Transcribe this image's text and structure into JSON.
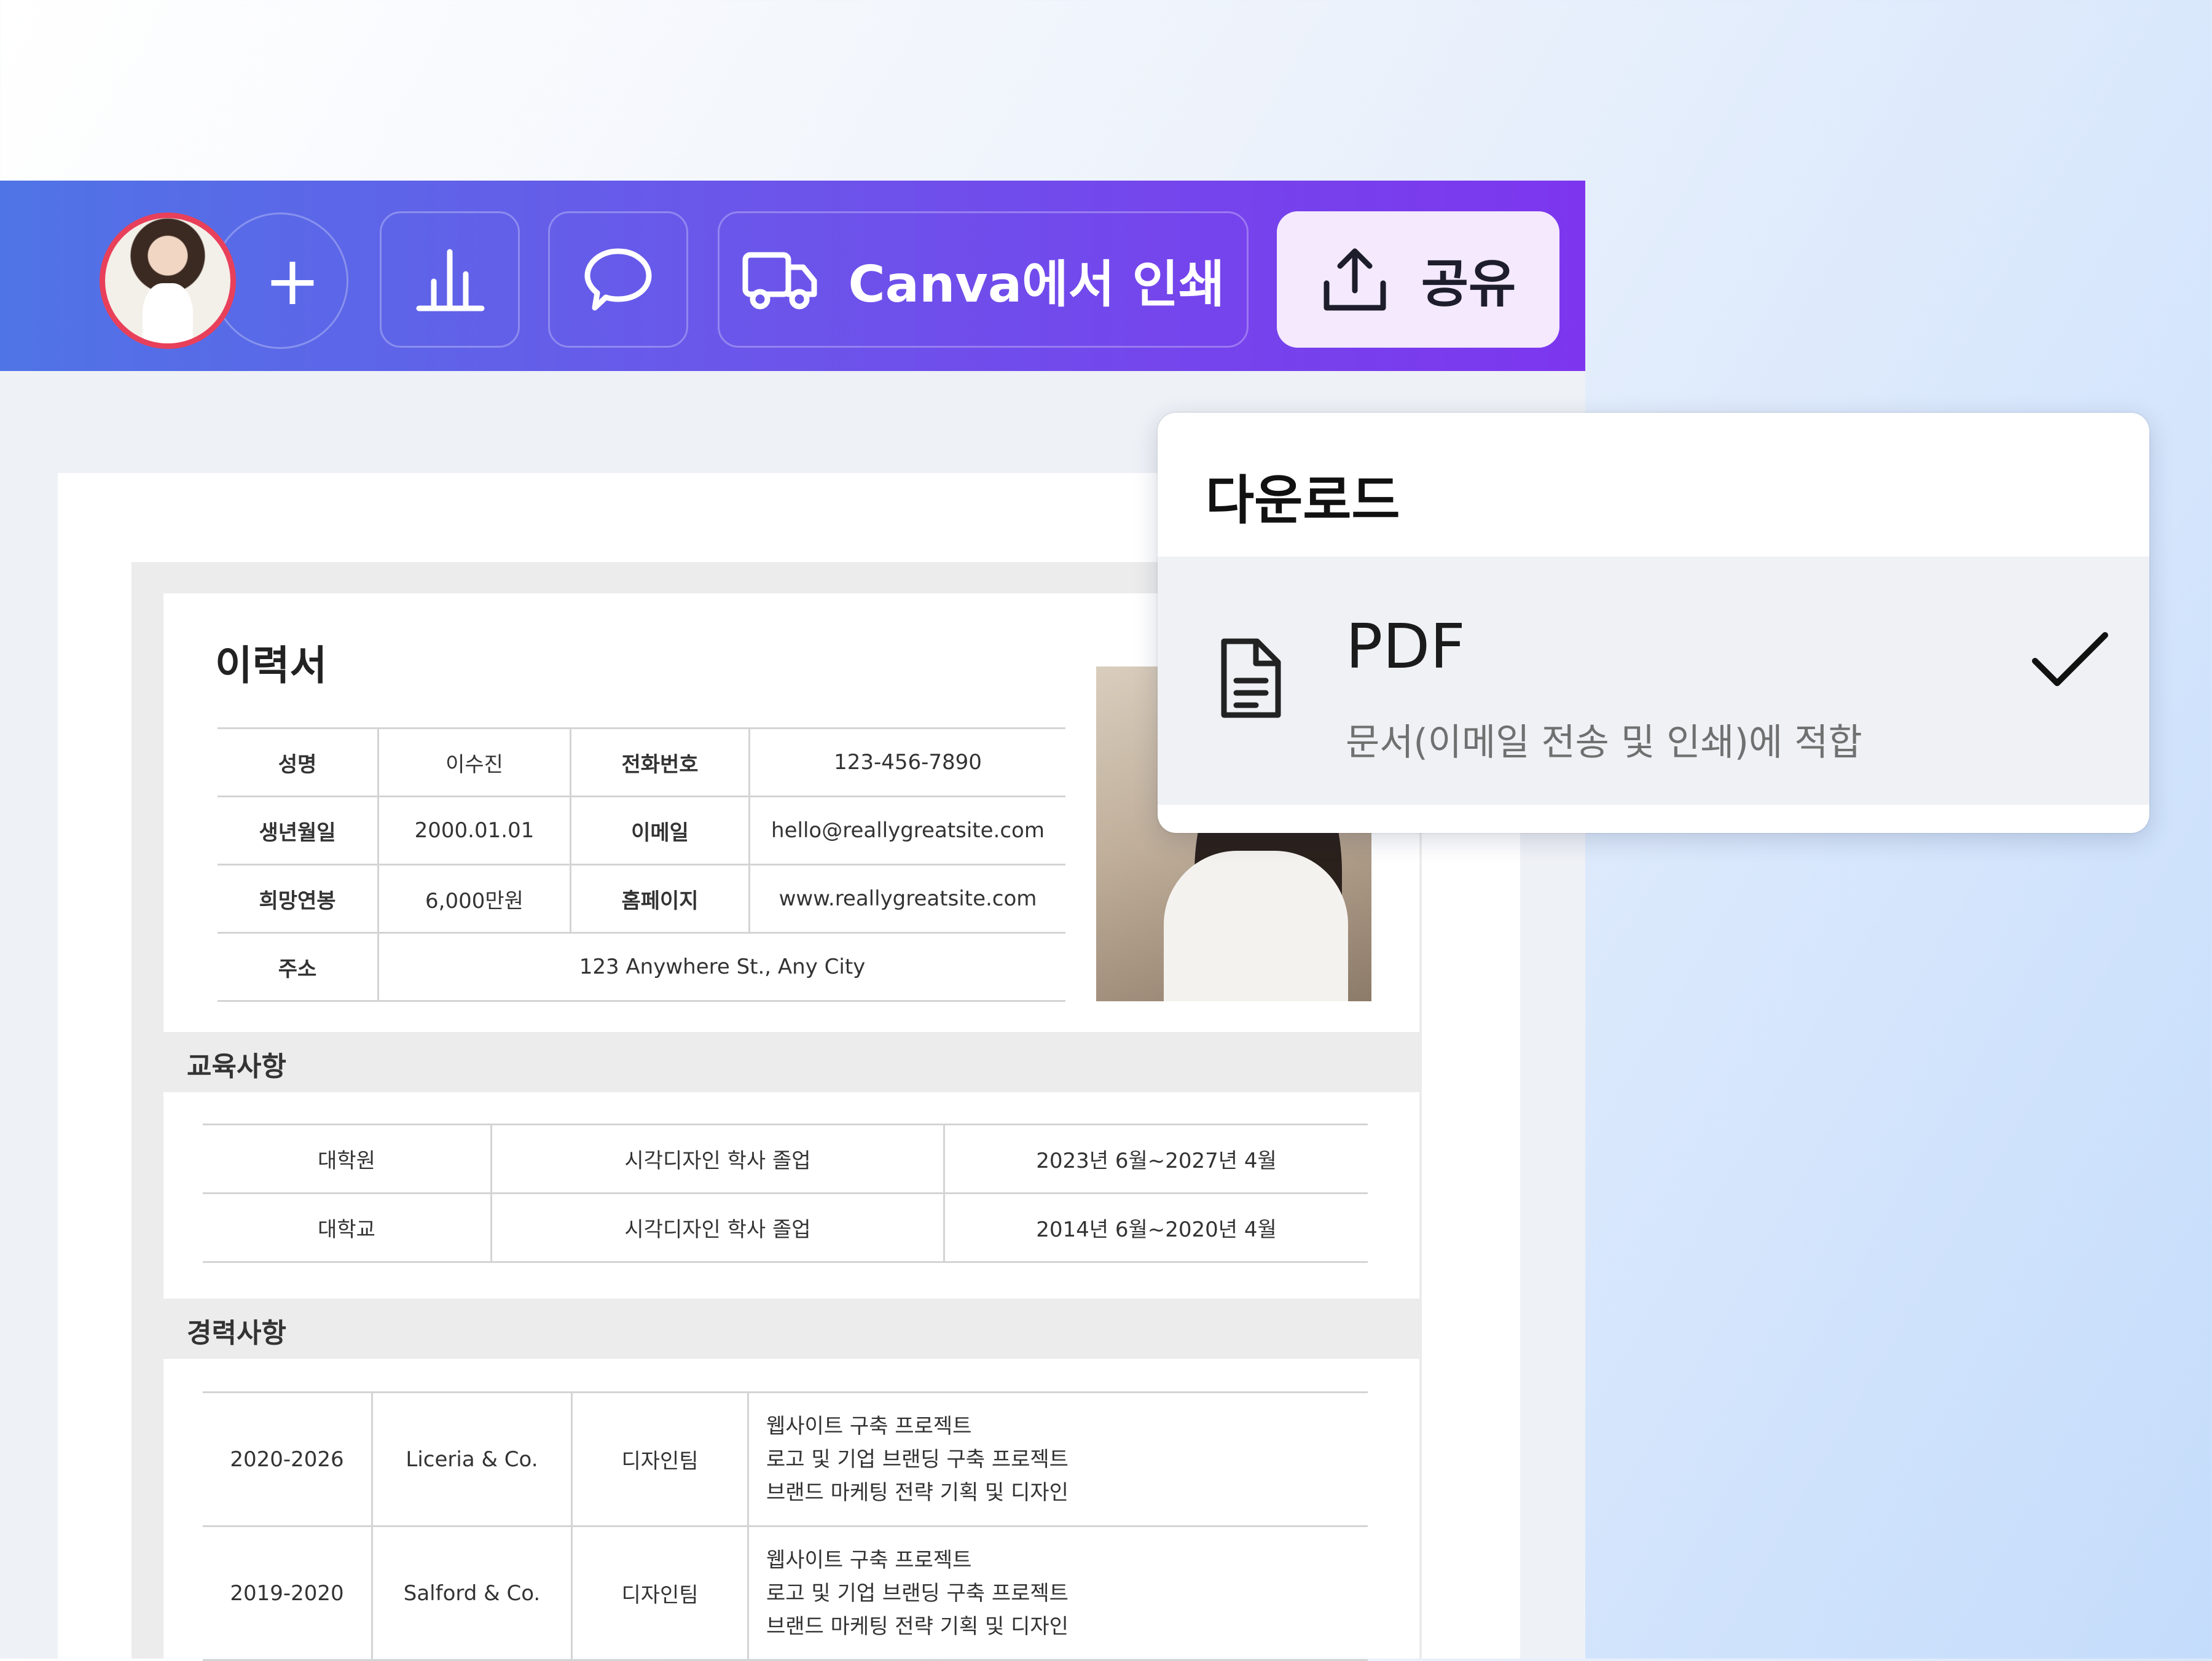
{
  "toolbar": {
    "add_symbol": "+",
    "print_label": "Canva에서 인쇄",
    "share_label": "공유"
  },
  "download_menu": {
    "title": "다운로드",
    "item": {
      "label": "PDF",
      "description": "문서(이메일 전송 및 인쇄)에 적합",
      "selected": true
    }
  },
  "resume": {
    "title": "이력서",
    "info_rows": [
      {
        "label1": "성명",
        "value1": "이수진",
        "label2": "전화번호",
        "value2": "123-456-7890"
      },
      {
        "label1": "생년월일",
        "value1": "2000.01.01",
        "label2": "이메일",
        "value2": "hello@reallygreatsite.com"
      },
      {
        "label1": "희망연봉",
        "value1": "6,000만원",
        "label2": "홈페이지",
        "value2": "www.reallygreatsite.com"
      }
    ],
    "address": {
      "label": "주소",
      "value": "123 Anywhere St., Any City"
    },
    "education_title": "교육사항",
    "education": [
      {
        "school": "대학원",
        "degree": "시각디자인 학사 졸업",
        "period": "2023년 6월~2027년 4월"
      },
      {
        "school": "대학교",
        "degree": "시각디자인 학사 졸업",
        "period": "2014년 6월~2020년 4월"
      }
    ],
    "career_title": "경력사항",
    "career": [
      {
        "years": "2020-2026",
        "company": "Liceria & Co.",
        "team": "디자인팀",
        "tasks": [
          "웹사이트 구축 프로젝트",
          "로고 및 기업 브랜딩 구축 프로젝트",
          "브랜드 마케팅 전략 기획 및 디자인"
        ]
      },
      {
        "years": "2019-2020",
        "company": "Salford & Co.",
        "team": "디자인팀",
        "tasks": [
          "웹사이트 구축 프로젝트",
          "로고 및 기업 브랜딩 구축 프로젝트",
          "브랜드 마케팅 전략 기획 및 디자인"
        ]
      }
    ]
  },
  "colors": {
    "toolbar_start": "#4f74e6",
    "toolbar_end": "#7d36ee",
    "share_button": "#f4e9fd",
    "avatar_ring": "#e8405a"
  },
  "icons": {
    "add": "plus-icon",
    "insights": "bar-chart-icon",
    "comments": "speech-bubble-icon",
    "print": "delivery-truck-icon",
    "share": "upload-icon",
    "pdf": "document-icon",
    "selected": "checkmark-icon"
  }
}
